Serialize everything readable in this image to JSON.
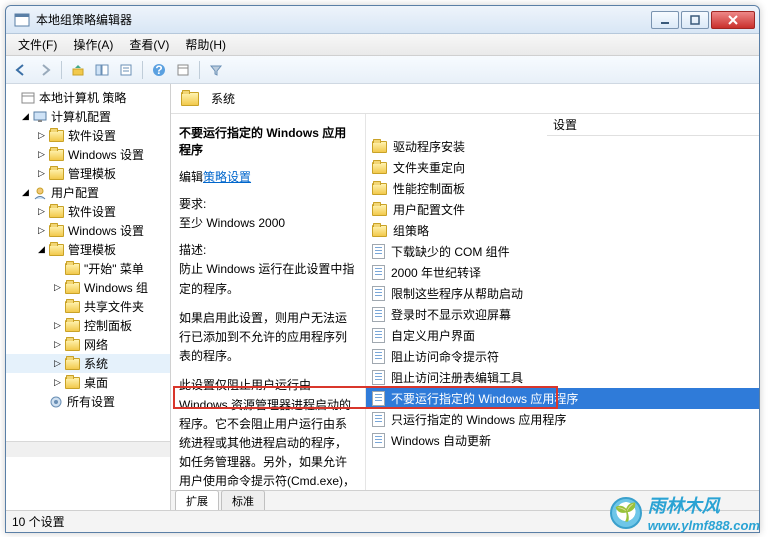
{
  "window": {
    "title": "本地组策略编辑器"
  },
  "menu": {
    "file": "文件(F)",
    "action": "操作(A)",
    "view": "查看(V)",
    "help": "帮助(H)"
  },
  "tree": {
    "root": "本地计算机 策略",
    "computerConfig": "计算机配置",
    "cc_software": "软件设置",
    "cc_windows": "Windows 设置",
    "cc_admin": "管理模板",
    "userConfig": "用户配置",
    "uc_software": "软件设置",
    "uc_windows": "Windows 设置",
    "uc_admin": "管理模板",
    "startMenu": "\"开始\" 菜单",
    "windowsComp": "Windows 组",
    "sharedFolders": "共享文件夹",
    "controlPanel": "控制面板",
    "network": "网络",
    "system": "系统",
    "desktop": "桌面",
    "allSettings": "所有设置"
  },
  "rightHeader": {
    "title": "系统",
    "settingsCol": "设置"
  },
  "detail": {
    "title": "不要运行指定的 Windows 应用程序",
    "editPrefix": "编辑",
    "editLink": "策略设置",
    "reqLabel": "要求:",
    "reqValue": "至少 Windows 2000",
    "descLabel": "描述:",
    "desc1": "防止 Windows 运行在此设置中指定的程序。",
    "desc2": "如果启用此设置，则用户无法运行已添加到不允许的应用程序列表的程序。",
    "desc3": "此设置仅阻止用户运行由 Windows 资源管理器进程启动的程序。它不会阻止用户运行由系统进程或其他进程启动的程序，如任务管理器。另外，如果允许用户使用命令提示符(Cmd.exe)，则此"
  },
  "settingsList": {
    "folders": [
      "驱动程序安装",
      "文件夹重定向",
      "性能控制面板",
      "用户配置文件",
      "组策略"
    ],
    "items": [
      "下载缺少的 COM 组件",
      "2000 年世纪转译",
      "限制这些程序从帮助启动",
      "登录时不显示欢迎屏幕",
      "自定义用户界面",
      "阻止访问命令提示符",
      "阻止访问注册表编辑工具",
      "不要运行指定的 Windows 应用程序",
      "只运行指定的 Windows 应用程序",
      "Windows 自动更新"
    ],
    "selectedIndex": 7
  },
  "tabs": {
    "extended": "扩展",
    "standard": "标准"
  },
  "status": {
    "count": "10 个设置"
  },
  "watermark": {
    "cn": "雨林木风",
    "url": "www.ylmf888.com"
  }
}
